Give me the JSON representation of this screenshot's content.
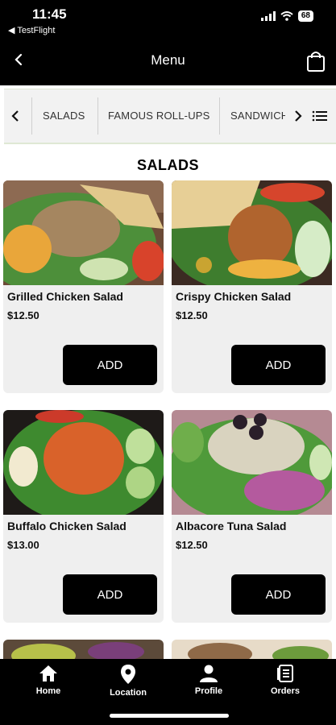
{
  "status": {
    "time": "11:45",
    "back_app": "◀ TestFlight",
    "battery": "68"
  },
  "header": {
    "title": "Menu"
  },
  "categories": [
    "SALADS",
    "FAMOUS ROLL-UPS",
    "SANDWICHES"
  ],
  "section": {
    "title": "SALADS"
  },
  "items": [
    {
      "name": "Grilled Chicken Salad",
      "price": "$12.50",
      "add_label": "ADD"
    },
    {
      "name": "Crispy Chicken Salad",
      "price": "$12.50",
      "add_label": "ADD"
    },
    {
      "name": "Buffalo Chicken Salad",
      "price": "$13.00",
      "add_label": "ADD"
    },
    {
      "name": "Albacore Tuna Salad",
      "price": "$12.50",
      "add_label": "ADD"
    }
  ],
  "tabs": [
    {
      "label": "Home",
      "icon": "home-icon"
    },
    {
      "label": "Location",
      "icon": "location-pin-icon"
    },
    {
      "label": "Profile",
      "icon": "profile-icon"
    },
    {
      "label": "Orders",
      "icon": "orders-icon"
    }
  ],
  "colors": {
    "bars": "#000000",
    "card_bg": "#efefef",
    "button": "#000000",
    "accent_line": "#dfe8d4"
  }
}
